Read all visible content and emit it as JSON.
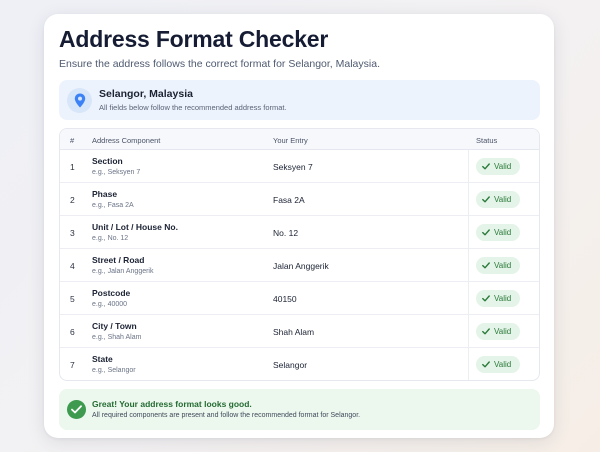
{
  "header": {
    "title": "Address Format Checker",
    "subtitle": "Ensure the address follows the correct format for Selangor, Malaysia."
  },
  "info": {
    "icon": "location-pin-icon",
    "title": "Selangor, Malaysia",
    "description": "All fields below follow the recommended address format."
  },
  "table": {
    "headers": [
      "#",
      "Address Component",
      "Your Entry",
      "Status"
    ],
    "rows": [
      {
        "num": "1",
        "component": "Section",
        "example": "e.g., Seksyen 7",
        "entry": "Seksyen 7",
        "status": "Valid"
      },
      {
        "num": "2",
        "component": "Phase",
        "example": "e.g., Fasa 2A",
        "entry": "Fasa 2A",
        "status": "Valid"
      },
      {
        "num": "3",
        "component": "Unit / Lot / House No.",
        "example": "e.g., No. 12",
        "entry": "No. 12",
        "status": "Valid"
      },
      {
        "num": "4",
        "component": "Street / Road",
        "example": "e.g., Jalan Anggerik",
        "entry": "Jalan Anggerik",
        "status": "Valid"
      },
      {
        "num": "5",
        "component": "Postcode",
        "example": "e.g., 40000",
        "entry": "40150",
        "status": "Valid"
      },
      {
        "num": "6",
        "component": "City / Town",
        "example": "e.g., Shah Alam",
        "entry": "Shah Alam",
        "status": "Valid"
      },
      {
        "num": "7",
        "component": "State",
        "example": "e.g., Selangor",
        "entry": "Selangor",
        "status": "Valid"
      }
    ]
  },
  "result": {
    "icon": "check-circle-icon",
    "title": "Great! Your address format looks good.",
    "description": "All required components are present and follow the recommended format for Selangor."
  },
  "colors": {
    "accent": "#3b82f6",
    "valid": "#2b7a3b",
    "valid_bg": "#e4f4e8"
  }
}
